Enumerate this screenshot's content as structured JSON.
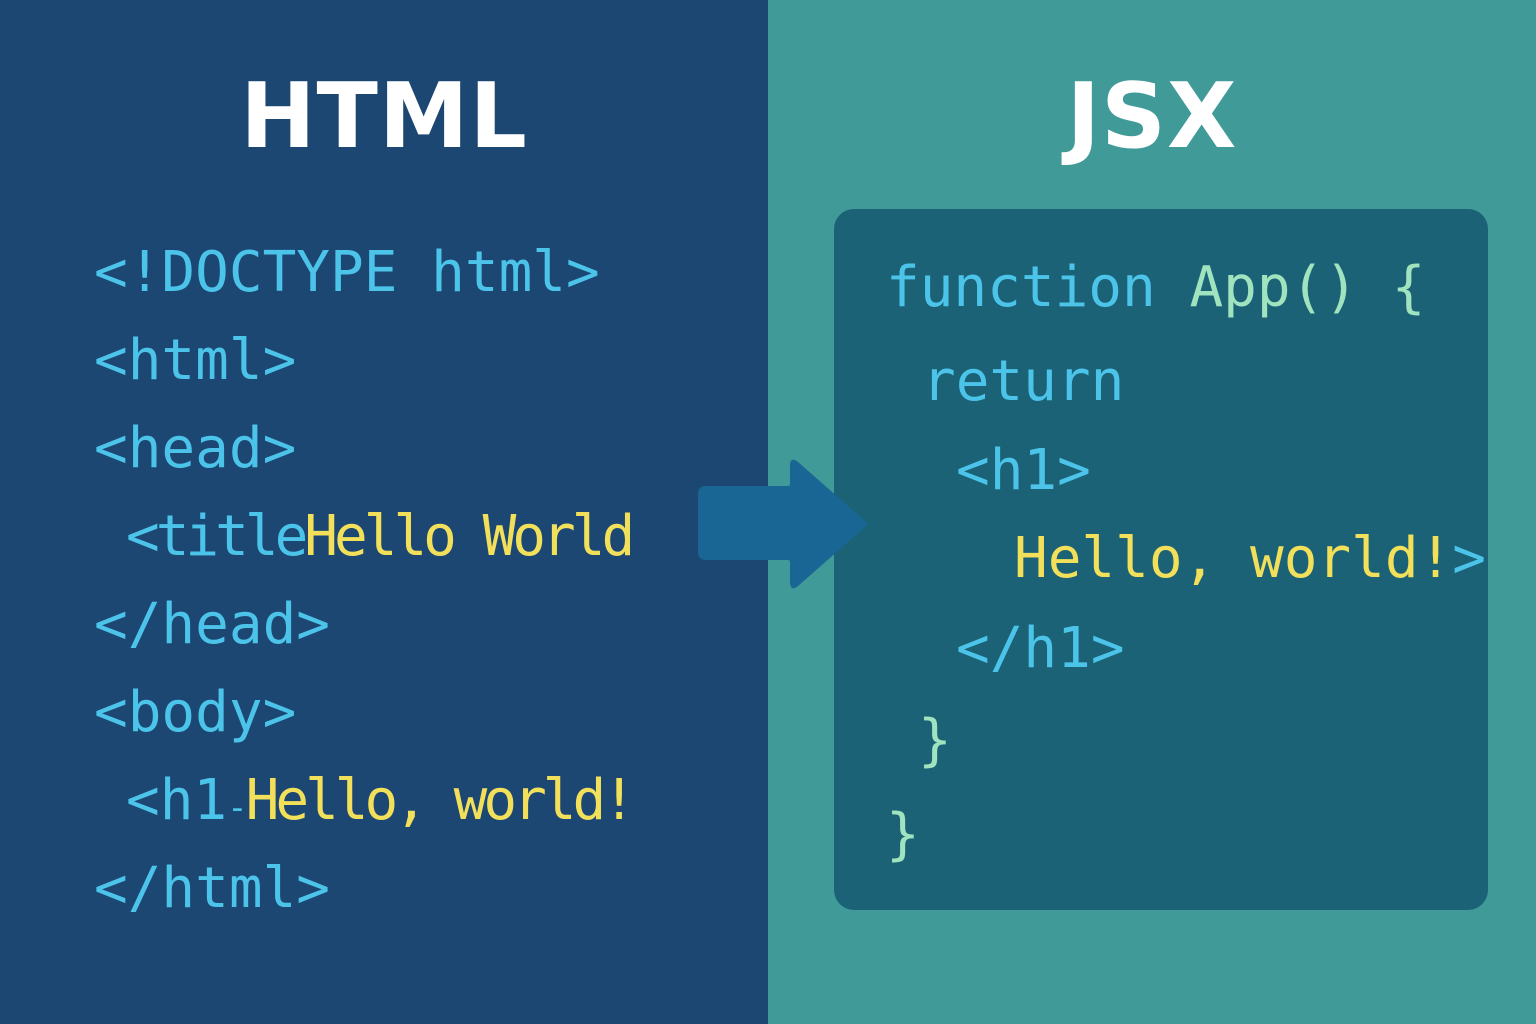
{
  "headings": {
    "html": "HTML",
    "jsx": "JSX"
  },
  "html_code": {
    "line1": "<!DOCTYPE html>",
    "line2": "<html>",
    "line3": "<head>",
    "line4_tag": "<title",
    "line4_text": "Hello World",
    "line5": "</head>",
    "line6": "<body>",
    "line7_tag": "<h1",
    "line7_dash": "-",
    "line7_text": "Hello, world!",
    "line8": "</html>"
  },
  "jsx_code": {
    "line1_kw": "function",
    "line1_fn": "App() {",
    "line2": "return",
    "line3": "<h1>",
    "line4_text": "Hello, world!",
    "line4_tag": ">",
    "line5": "</h1>",
    "line6": "}",
    "line7": "}"
  },
  "colors": {
    "left_bg": "#1c4773",
    "right_bg": "#3f9a98",
    "panel_bg": "#1b6276",
    "tag": "#4cc4ea",
    "text": "#f2df5a",
    "function_name": "#9fe3bf",
    "arrow": "#196694"
  },
  "icons": {
    "arrow": "right-arrow-icon"
  }
}
